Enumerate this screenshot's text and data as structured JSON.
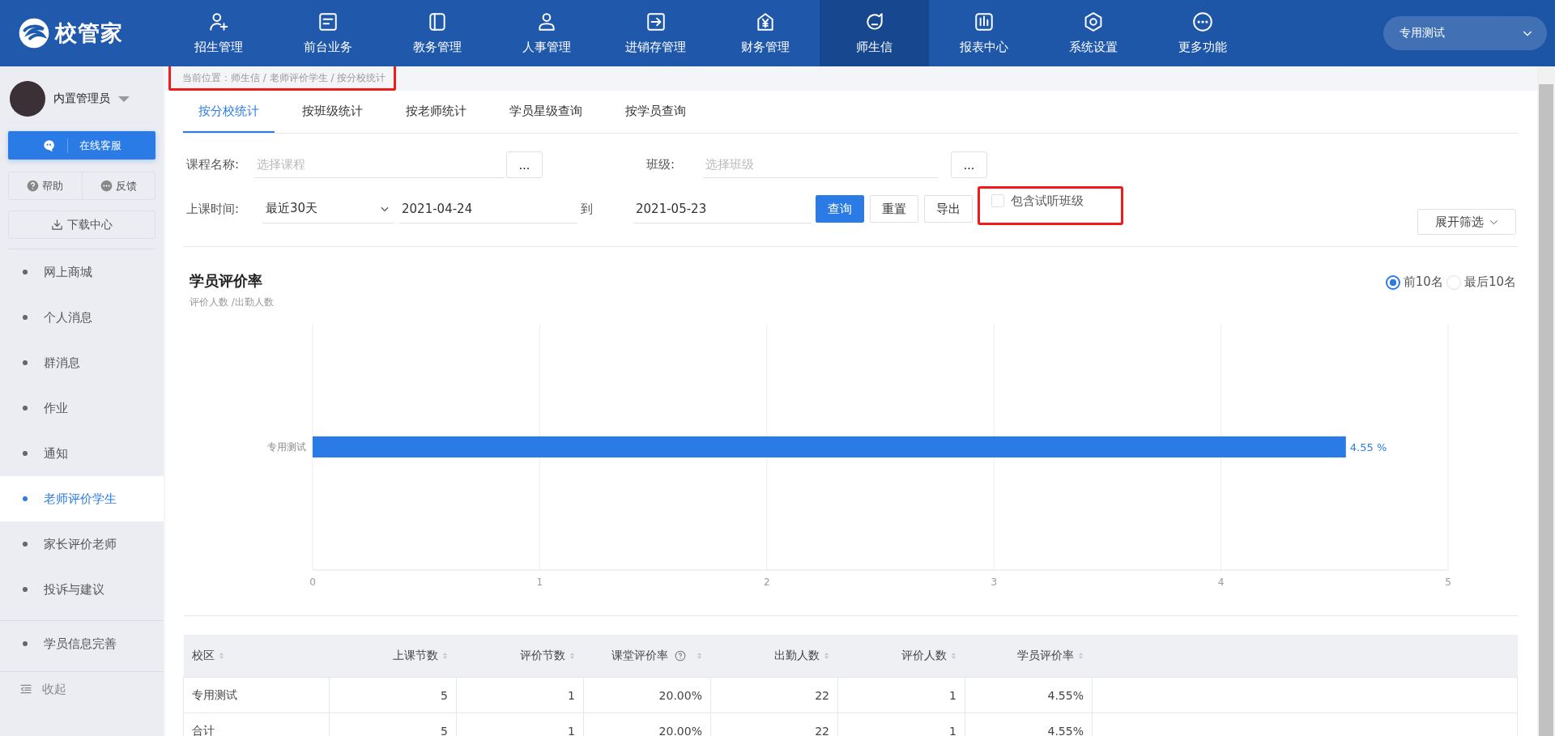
{
  "header": {
    "logo": "校管家",
    "nav": [
      {
        "label": "招生管理",
        "selected": false
      },
      {
        "label": "前台业务",
        "selected": false
      },
      {
        "label": "教务管理",
        "selected": false
      },
      {
        "label": "人事管理",
        "selected": false
      },
      {
        "label": "进销存管理",
        "selected": false
      },
      {
        "label": "财务管理",
        "selected": false
      },
      {
        "label": "师生信",
        "selected": true
      },
      {
        "label": "报表中心",
        "selected": false
      },
      {
        "label": "系统设置",
        "selected": false
      },
      {
        "label": "更多功能",
        "selected": false
      }
    ],
    "campus_select": "专用测试"
  },
  "sidebar": {
    "user": "内置管理员",
    "online_service": "在线客服",
    "help": "帮助",
    "feedback": "反馈",
    "download": "下载中心",
    "items": [
      {
        "label": "网上商城",
        "selected": false
      },
      {
        "label": "个人消息",
        "selected": false
      },
      {
        "label": "群消息",
        "selected": false
      },
      {
        "label": "作业",
        "selected": false
      },
      {
        "label": "通知",
        "selected": false
      },
      {
        "label": "老师评价学生",
        "selected": true
      },
      {
        "label": "家长评价老师",
        "selected": false
      },
      {
        "label": "投诉与建议",
        "selected": false
      }
    ],
    "extra_items": [
      {
        "label": "学员信息完善",
        "selected": false
      }
    ],
    "collapse": "收起"
  },
  "breadcrumb": {
    "text": "当前位置：师生信 / 老师评价学生 / 按分校统计",
    "highlighted": true
  },
  "tabs": [
    {
      "label": "按分校统计",
      "selected": true
    },
    {
      "label": "按班级统计",
      "selected": false
    },
    {
      "label": "按老师统计",
      "selected": false
    },
    {
      "label": "学员星级查询",
      "selected": false
    },
    {
      "label": "按学员查询",
      "selected": false
    }
  ],
  "filters": {
    "pickers": [
      {
        "label": "课程名称:",
        "placeholder": "选择课程",
        "button": "..."
      },
      {
        "label": "班级:",
        "placeholder": "选择班级",
        "button": "..."
      }
    ],
    "time": {
      "label": "上课时间:",
      "range": "最近30天",
      "start": "2021-04-24",
      "to": "到",
      "end": "2021-05-23"
    },
    "buttons": [
      {
        "label": "查询",
        "kind": "primary"
      },
      {
        "label": "重置",
        "kind": "default"
      },
      {
        "label": "导出",
        "kind": "default"
      }
    ],
    "include_trial": {
      "label": "包含试听班级",
      "checked": false,
      "highlighted": true
    },
    "expand": "展开筛选"
  },
  "chart_section": {
    "title": "学员评价率",
    "subtitle": "评价人数 /出勤人数",
    "ranking": [
      {
        "label": "前10名",
        "selected": true
      },
      {
        "label": "最后10名",
        "selected": false
      }
    ],
    "chart_data": {
      "type": "bar",
      "orientation": "horizontal",
      "categories": [
        "专用测试"
      ],
      "values": [
        4.55
      ],
      "grid": true,
      "xlim": [
        0,
        5
      ],
      "xticks": [
        0,
        1,
        2,
        3,
        4,
        5
      ],
      "value_labels": [
        "4.55 %"
      ]
    }
  },
  "table": {
    "columns": [
      {
        "label": "校区",
        "info": false
      },
      {
        "label": "上课节数",
        "info": false
      },
      {
        "label": "评价节数",
        "info": false
      },
      {
        "label": "课堂评价率",
        "info": true
      },
      {
        "label": "出勤人数",
        "info": false
      },
      {
        "label": "评价人数",
        "info": false
      },
      {
        "label": "学员评价率",
        "info": false
      }
    ],
    "rows": [
      [
        "专用测试",
        "5",
        "1",
        "20.00%",
        "22",
        "1",
        "4.55%"
      ],
      [
        "合计",
        "5",
        "1",
        "20.00%",
        "22",
        "1",
        "4.55%"
      ]
    ]
  }
}
